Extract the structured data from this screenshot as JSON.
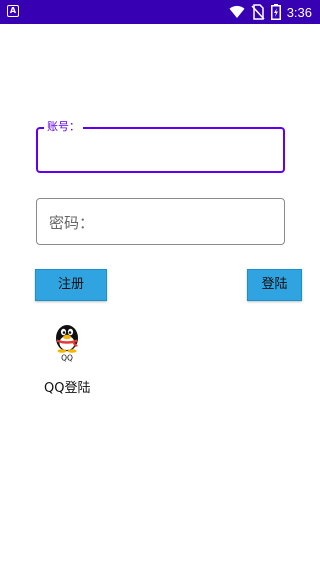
{
  "status_bar": {
    "app_icon_letter": "A",
    "time": "3:36",
    "icons": [
      "wifi-icon",
      "no-sim-icon",
      "battery-charging-icon"
    ]
  },
  "form": {
    "account_label": "账号：",
    "account_value": "",
    "password_placeholder": "密码："
  },
  "buttons": {
    "register_label": "注册",
    "login_label": "登陆"
  },
  "qq_login": {
    "logo_text": "QQ",
    "label": "QQ登陆"
  },
  "colors": {
    "status_bar": "#3700b3",
    "accent": "#6200ee",
    "button": "#2fa4e0"
  }
}
